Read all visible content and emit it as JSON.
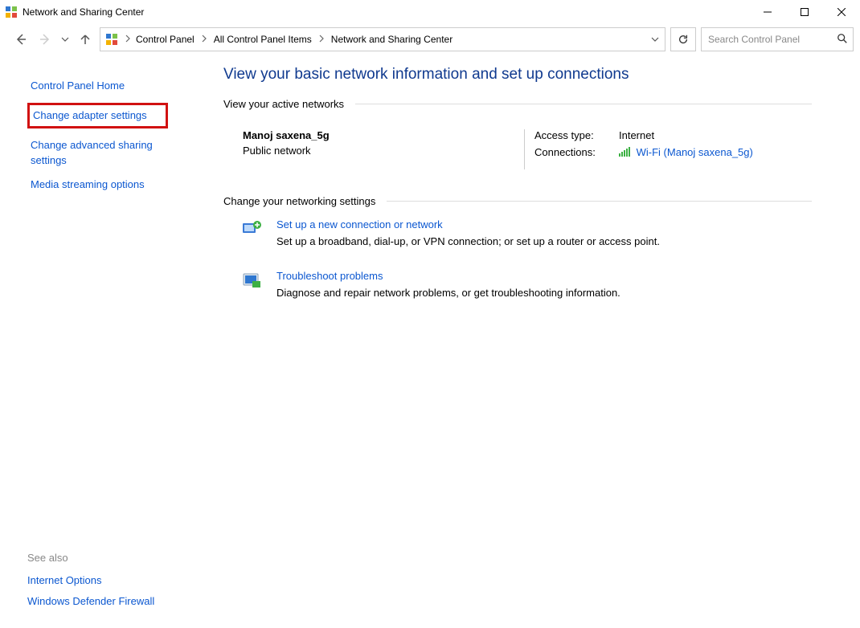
{
  "window": {
    "title": "Network and Sharing Center"
  },
  "breadcrumb": {
    "item1": "Control Panel",
    "item2": "All Control Panel Items",
    "item3": "Network and Sharing Center"
  },
  "search": {
    "placeholder": "Search Control Panel"
  },
  "sidebar": {
    "home": "Control Panel Home",
    "adapter": "Change adapter settings",
    "advanced": "Change advanced sharing settings",
    "media": "Media streaming options"
  },
  "seealso": {
    "header": "See also",
    "internet": "Internet Options",
    "firewall": "Windows Defender Firewall"
  },
  "main": {
    "heading": "View your basic network information and set up connections",
    "section1": "View your active networks",
    "network": {
      "name": "Manoj saxena_5g",
      "type": "Public network",
      "access_label": "Access type:",
      "access_value": "Internet",
      "conn_label": "Connections:",
      "conn_value": "Wi-Fi (Manoj saxena_5g)"
    },
    "section2": "Change your networking settings",
    "setup": {
      "title": "Set up a new connection or network",
      "desc": "Set up a broadband, dial-up, or VPN connection; or set up a router or access point."
    },
    "trouble": {
      "title": "Troubleshoot problems",
      "desc": "Diagnose and repair network problems, or get troubleshooting information."
    }
  }
}
